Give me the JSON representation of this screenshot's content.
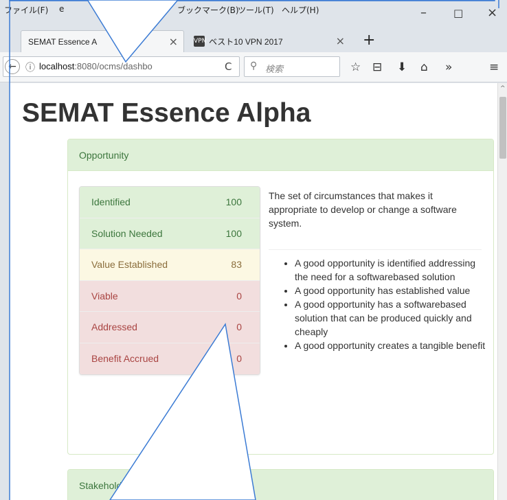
{
  "menu": {
    "file": "ファイル(F)",
    "partial": "e",
    "bookmarks": "ブックマーク(B)",
    "tools": "ツール(T)",
    "help": "ヘルプ(H)"
  },
  "window_controls": {
    "minimize": "–",
    "maximize": "□",
    "close": "×"
  },
  "tabs": [
    {
      "label": "SEMAT Essence A",
      "close": "×",
      "active": true
    },
    {
      "label": "ベスト10 VPN 2017",
      "close": "×",
      "active": false,
      "favicon": "VPN"
    }
  ],
  "new_tab": "+",
  "nav": {
    "back": "←",
    "info": "ⓘ",
    "url_host": "localhost",
    "url_rest": ":8080/ocms/dashbo",
    "reload": "C",
    "search_icon": "🔍",
    "search_placeholder": "検索",
    "star": "☆",
    "reader": "⊟",
    "download": "⬇",
    "home": "⌂",
    "more": "»",
    "menu": "≡"
  },
  "page": {
    "title": "SEMAT Essence Alpha",
    "panels": [
      {
        "heading": "Opportunity",
        "states": [
          {
            "name": "Identified",
            "value": "100",
            "status": "success"
          },
          {
            "name": "Solution Needed",
            "value": "100",
            "status": "success"
          },
          {
            "name": "Value Established",
            "value": "83",
            "status": "warning"
          },
          {
            "name": "Viable",
            "value": "0",
            "status": "danger"
          },
          {
            "name": "Addressed",
            "value": "0",
            "status": "danger"
          },
          {
            "name": "Benefit Accrued",
            "value": "0",
            "status": "danger"
          }
        ],
        "description": "The set of circumstances that makes it appropriate to develop or change a software system.",
        "checklist": [
          "A good opportunity is identified addressing the need for a softwarebased solution",
          "A good opportunity has established value",
          "A good opportunity has a softwarebased solution that can be produced quickly and cheaply",
          "A good opportunity creates a tangible benefit"
        ]
      },
      {
        "heading": "Stakehold"
      }
    ]
  },
  "colors": {
    "success_bg": "#dff0d8",
    "warning_bg": "#fcf8e3",
    "danger_bg": "#f2dede",
    "callout_line": "#3b7bd4"
  }
}
